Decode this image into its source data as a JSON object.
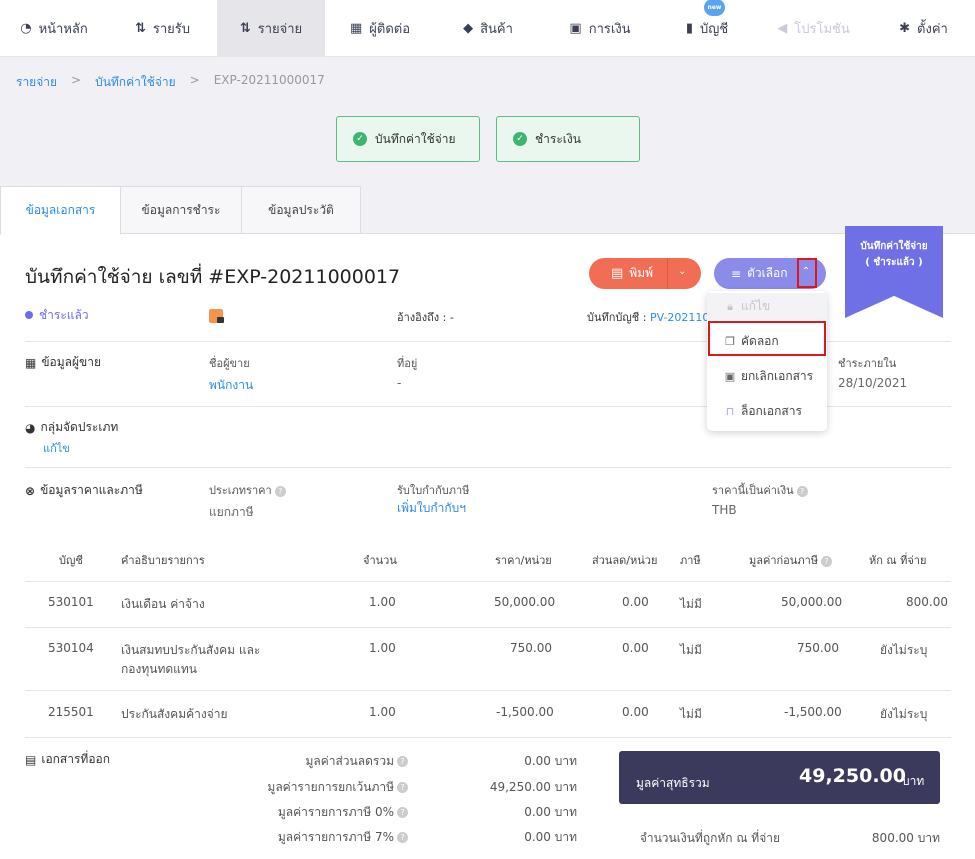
{
  "nav": [
    {
      "icon": "dashboard-icon",
      "label": "หน้าหลัก"
    },
    {
      "icon": "income-icon",
      "label": "รายรับ"
    },
    {
      "icon": "expense-icon",
      "label": "รายจ่าย",
      "active": true
    },
    {
      "icon": "contact-icon",
      "label": "ผู้ติดต่อ"
    },
    {
      "icon": "product-icon",
      "label": "สินค้า"
    },
    {
      "icon": "finance-icon",
      "label": "การเงิน"
    },
    {
      "icon": "account-icon",
      "label": "บัญชี",
      "badge": "new"
    },
    {
      "icon": "promotion-icon",
      "label": "โปรโมชัน",
      "disabled": true
    },
    {
      "icon": "settings-icon",
      "label": "ตั้งค่า"
    }
  ],
  "breadcrumb": {
    "root": "รายจ่าย",
    "parent": "บันทึกค่าใช้จ่าย",
    "current": "EXP-20211000017",
    "sep": ">"
  },
  "steps": [
    "บันทึกค่าใช้จ่าย",
    "ชำระเงิน"
  ],
  "tabs": [
    "ข้อมูลเอกสาร",
    "ข้อมูลการชำระ",
    "ข้อมูลประวัติ"
  ],
  "doc": {
    "title": "บันทึกค่าใช้จ่าย เลขที่ #EXP-20211000017",
    "status": "ชำระแล้ว",
    "ref_label": "อ้างอิงถึง :",
    "ref_value": "-",
    "journal_label": "บันทึกบัญชี :",
    "journal_value": "PV-202110"
  },
  "actions": {
    "print": "พิมพ์",
    "options": "ตัวเลือก"
  },
  "ribbon": {
    "line1": "บันทึกค่าใช้จ่าย",
    "line2": "( ชำระแล้ว )"
  },
  "menu": [
    {
      "icon": "lock-icon",
      "label": "แก้ไข",
      "disabled": true
    },
    {
      "icon": "copy-icon",
      "label": "คัดลอก"
    },
    {
      "icon": "cancel-doc-icon",
      "label": "ยกเลิกเอกสาร"
    },
    {
      "icon": "lock-doc-icon",
      "label": "ล็อกเอกสาร"
    }
  ],
  "vendor": {
    "section": "ข้อมูลผู้ขาย",
    "name_label": "ชื่อผู้ขาย",
    "name": "พนักงาน",
    "address_label": "ที่อยู่",
    "address": "-",
    "pay_label": "ชำระภายใน",
    "pay_date": "28/10/2021"
  },
  "group": {
    "section": "กลุ่มจัดประเภท",
    "edit": "แก้ไข"
  },
  "pricing": {
    "section": "ข้อมูลราคาและภาษี",
    "price_type_label": "ประเภทราคา",
    "price_type": "แยกภาษี",
    "tax_invoice_label": "รับใบกำกับภาษี",
    "tax_invoice_link": "เพิ่มใบกำกับฯ",
    "currency_label": "ราคานี้เป็นค่าเงิน",
    "currency": "THB"
  },
  "table": {
    "headers": [
      "บัญชี",
      "คำอธิบายรายการ",
      "จำนวน",
      "ราคา/หน่วย",
      "ส่วนลด/หน่วย",
      "ภาษี",
      "มูลค่าก่อนภาษี",
      "หัก ณ ที่จ่าย"
    ],
    "rows": [
      {
        "account": "530101",
        "desc1": "เงินเดือน ค่าจ้าง",
        "desc2": "",
        "qty": "1.00",
        "price": "50,000.00",
        "discount": "0.00",
        "tax": "ไม่มี",
        "pretax": "50,000.00",
        "wht": "800.00"
      },
      {
        "account": "530104",
        "desc1": "เงินสมทบประกันสังคม และ",
        "desc2": "กองทุนทดแทน",
        "qty": "1.00",
        "price": "750.00",
        "discount": "0.00",
        "tax": "ไม่มี",
        "pretax": "750.00",
        "wht": "ยังไม่ระบุ"
      },
      {
        "account": "215501",
        "desc1": "ประกันสังคมค้างจ่าย",
        "desc2": "",
        "qty": "1.00",
        "price": "-1,500.00",
        "discount": "0.00",
        "tax": "ไม่มี",
        "pretax": "-1,500.00",
        "wht": "ยังไม่ระบุ"
      }
    ]
  },
  "docs_out": {
    "section": "เอกสารที่ออก"
  },
  "summary": [
    {
      "label": "มูลค่าส่วนลดรวม",
      "value": "0.00 บาท"
    },
    {
      "label": "มูลค่ารายการยกเว้นภาษี",
      "value": "49,250.00 บาท"
    },
    {
      "label": "มูลค่ารายการภาษี 0%",
      "value": "0.00 บาท"
    },
    {
      "label": "มูลค่ารายการภาษี 7%",
      "value": "0.00 บาท"
    }
  ],
  "net": {
    "label": "มูลค่าสุทธิรวม",
    "amount": "49,250.00",
    "unit": "บาท"
  },
  "wht_total": {
    "label": "จำนวนเงินที่ถูกหัก ณ ที่จ่าย",
    "value": "800.00 บาท"
  },
  "colors": {
    "accent": "#2d8ce8",
    "print": "#f16e55",
    "options": "#8b8bea",
    "ribbon": "#7070e6",
    "success": "#3fb46c",
    "highlight": "#e0161b"
  }
}
